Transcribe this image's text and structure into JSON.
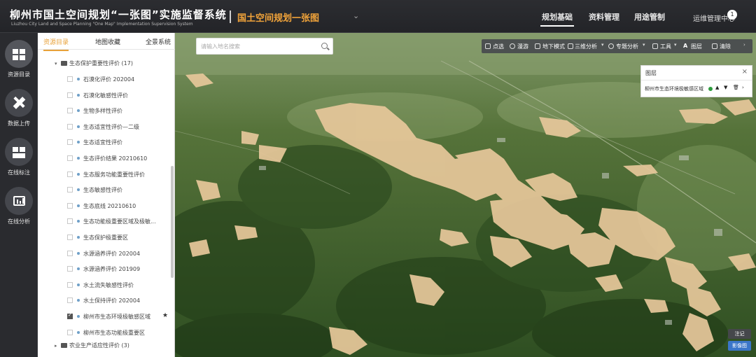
{
  "header": {
    "title": "柳州市国土空间规划“一张图”实施监督系统",
    "title_en": "Liuzhou City Land and Space Planning \"One Map\" Implementation Supervision System",
    "subtitle": "国土空间规划一张图",
    "nav": [
      "规划基础",
      "资料管理",
      "用途管制"
    ],
    "active_nav": "规划基础",
    "ops_label": "运维管理中心"
  },
  "sidebar": {
    "items": [
      {
        "label": "资源目录",
        "icon": "catalog-icon"
      },
      {
        "label": "数据上传",
        "icon": "ruler-pencil-icon"
      },
      {
        "label": "在线标注",
        "icon": "annotate-icon"
      },
      {
        "label": "在线分析",
        "icon": "analysis-icon"
      }
    ]
  },
  "panel": {
    "tabs": [
      "资源目录",
      "地图收藏",
      "全景系统"
    ],
    "group1": {
      "label": "生态保护重要性评价",
      "count": "(17)"
    },
    "layers": [
      {
        "label": "石漠化评价 202004",
        "checked": false
      },
      {
        "label": "石漠化敏感性评价",
        "checked": false
      },
      {
        "label": "生物多样性评价",
        "checked": false
      },
      {
        "label": "生态适宜性评价—二级",
        "checked": false
      },
      {
        "label": "生态适宜性评价",
        "checked": false
      },
      {
        "label": "生态评价结果 20210610",
        "checked": false
      },
      {
        "label": "生态服务功能重要性评价",
        "checked": false
      },
      {
        "label": "生态敏感性评价",
        "checked": false
      },
      {
        "label": "生态底线 20210610",
        "checked": false
      },
      {
        "label": "生态功能极重要区域及极敏...",
        "checked": false
      },
      {
        "label": "生态保护极重要区",
        "checked": false
      },
      {
        "label": "水源涵养评价 202004",
        "checked": false
      },
      {
        "label": "水源涵养评价 201909",
        "checked": false
      },
      {
        "label": "水土流失敏感性评价",
        "checked": false
      },
      {
        "label": "水土保持评价 202004",
        "checked": false
      },
      {
        "label": "柳州市生态环境极敏感区域",
        "checked": true
      },
      {
        "label": "柳州市生态功能极重要区",
        "checked": false
      }
    ],
    "group2": {
      "label": "农业生产适应性评价",
      "count": "(3)"
    }
  },
  "search": {
    "placeholder": "请输入地名搜索"
  },
  "toolbar": {
    "items": [
      "点选",
      "漫游",
      "地下模式",
      "三维分析",
      "专题分析",
      "工具",
      "图层",
      "清除"
    ]
  },
  "layer_panel": {
    "title": "图层",
    "item": "柳州市生态环境极敏感区域"
  },
  "map_buttons": {
    "annotate": "注记",
    "imagery": "影像图"
  },
  "colors": {
    "accent": "#e8a23a",
    "overlay": "#e6c79a",
    "layer_active": "#2e9c3e"
  }
}
